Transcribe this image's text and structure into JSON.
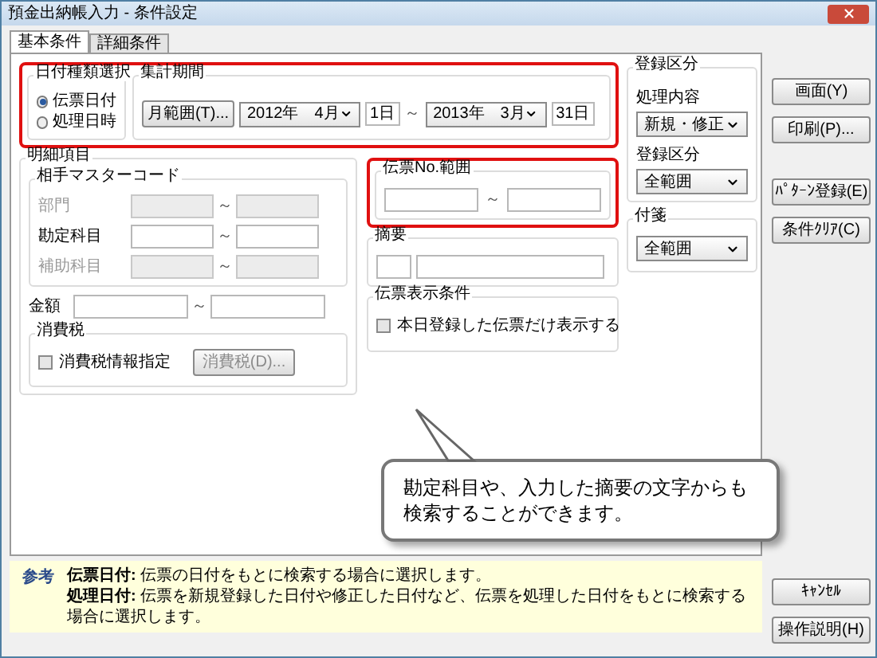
{
  "window": {
    "title": "預金出納帳入力 - 条件設定"
  },
  "tabs": [
    {
      "label": "基本条件",
      "selected": true
    },
    {
      "label": "詳細条件",
      "selected": false
    }
  ],
  "date_type": {
    "title": "日付種類選択",
    "options": [
      {
        "label": "伝票日付",
        "selected": true
      },
      {
        "label": "処理日時",
        "selected": false
      }
    ]
  },
  "period": {
    "title": "集計期間",
    "range_button": "月範囲(T)...",
    "from_month": "2012年　4月",
    "from_day": "1日",
    "separator": "～",
    "to_month": "2013年　3月",
    "to_day": "31日"
  },
  "detail": {
    "title": "明細項目",
    "master": {
      "title": "相手マスターコード",
      "rows": [
        {
          "label": "部門",
          "disabled": true,
          "separator": "～"
        },
        {
          "label": "勘定科目",
          "disabled": false,
          "separator": "～"
        },
        {
          "label": "補助科目",
          "disabled": true,
          "separator": "～"
        }
      ]
    },
    "amount": {
      "label": "金額",
      "separator": "～"
    },
    "tax": {
      "title": "消費税",
      "checkbox": {
        "label": "消費税情報指定",
        "checked": false
      },
      "button": {
        "label": "消費税(D)...",
        "disabled": true
      }
    }
  },
  "slip_no": {
    "title": "伝票No.範囲",
    "separator": "～"
  },
  "summary": {
    "title": "摘要"
  },
  "display": {
    "title": "伝票表示条件",
    "checkbox": {
      "label": "本日登録した伝票だけ表示する",
      "checked": false
    }
  },
  "registration": {
    "title": "登録区分",
    "fields": [
      {
        "label": "処理内容",
        "value": "新規・修正"
      },
      {
        "label": "登録区分",
        "value": "全範囲"
      }
    ]
  },
  "tag": {
    "title": "付箋",
    "value": "全範囲"
  },
  "top_buttons": [
    "画面(Y)",
    "印刷(P)..."
  ],
  "middle_buttons": [
    "ﾊﾟﾀｰﾝ登録(E)",
    "条件ｸﾘｱ(C)"
  ],
  "bottom_buttons": [
    "ｷｬﾝｾﾙ",
    "操作説明(H)"
  ],
  "callout": {
    "text": "勘定科目や、入力した摘要の文字からも検索することができます。"
  },
  "note": {
    "label": "参考",
    "lines": [
      "**伝票日付:** 伝票の日付をもとに検索する場合に選択します。",
      "**処理日付:** 伝票を新規登録した日付や修正した日付など、伝票を処理した日付をもとに検索する場合に選択します。"
    ]
  }
}
